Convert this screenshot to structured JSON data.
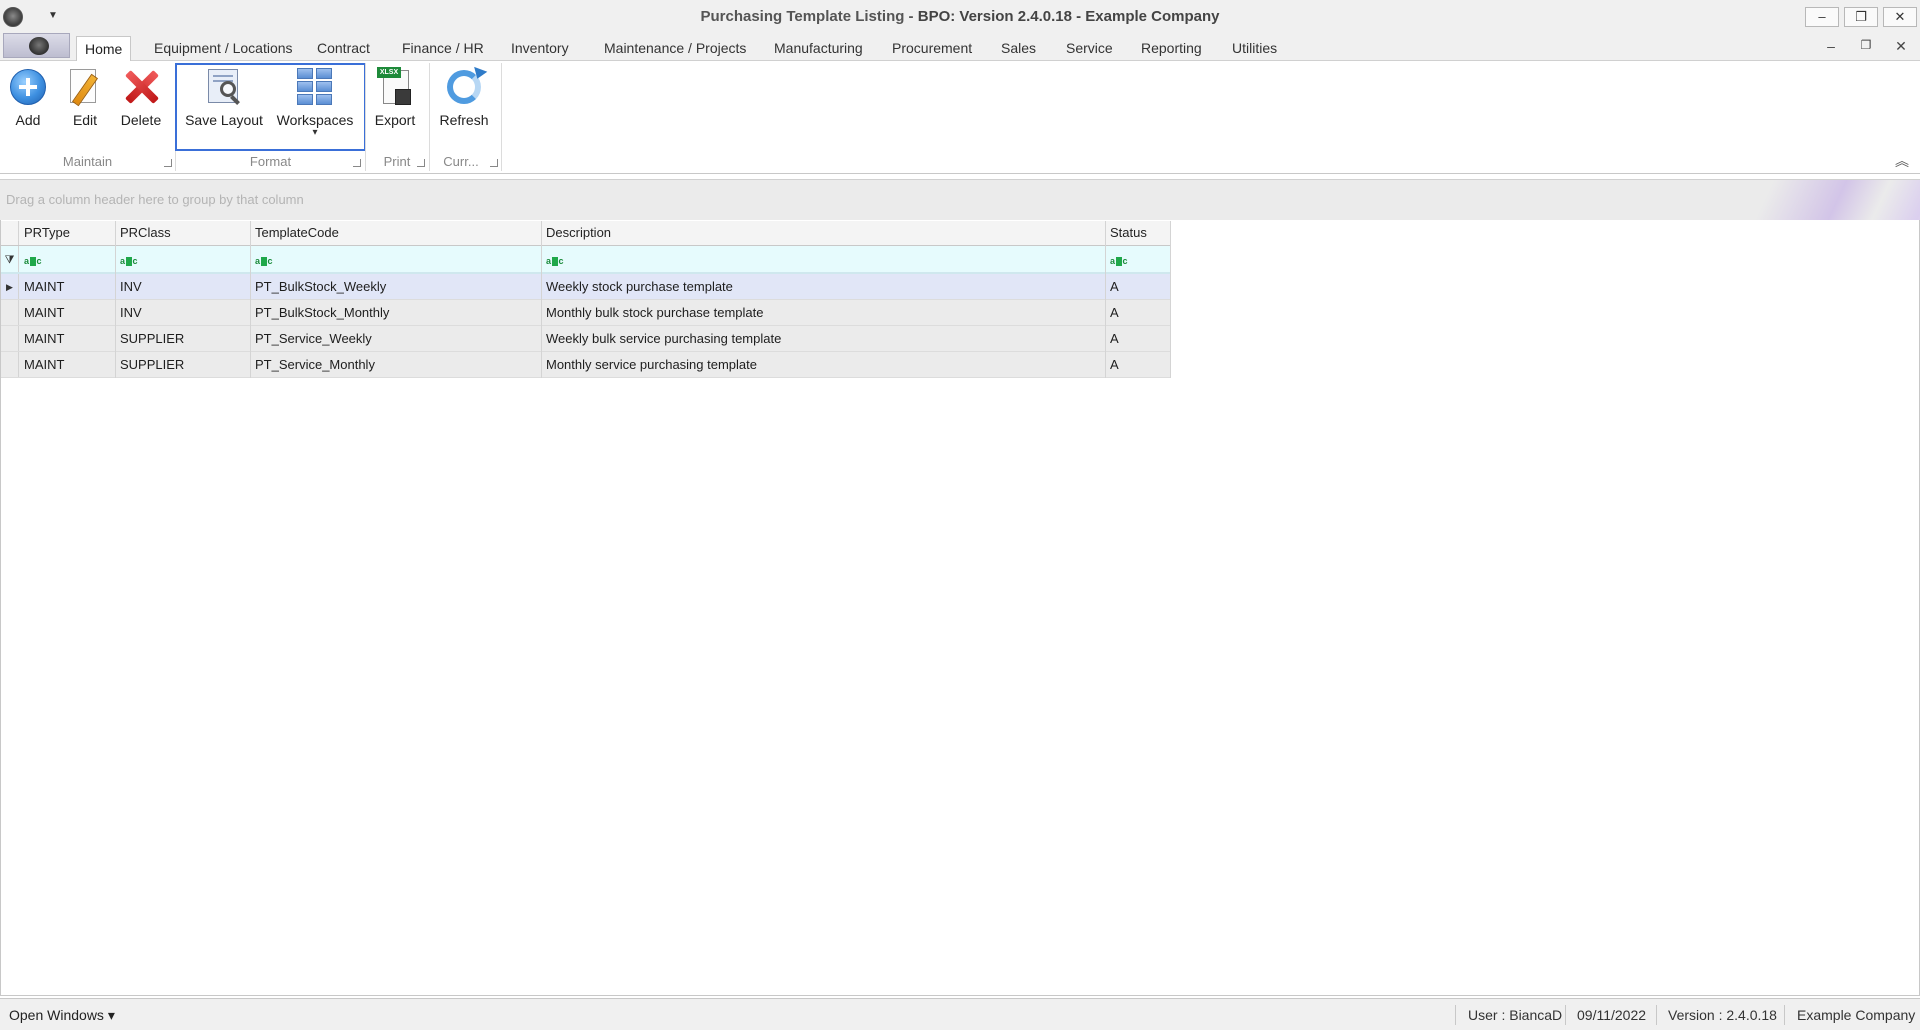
{
  "window": {
    "title_main": "Purchasing Template Listing - ",
    "title_sub": "BPO: Version 2.4.0.18 - Example Company",
    "minimize": "–",
    "restore": "❐",
    "close": "✕"
  },
  "qat_dropdown_glyph": "▼",
  "tabs": [
    {
      "label": "Home",
      "active": true
    },
    {
      "label": "Equipment / Locations"
    },
    {
      "label": "Contract"
    },
    {
      "label": "Finance / HR"
    },
    {
      "label": "Inventory"
    },
    {
      "label": "Maintenance / Projects"
    },
    {
      "label": "Manufacturing"
    },
    {
      "label": "Procurement"
    },
    {
      "label": "Sales"
    },
    {
      "label": "Service"
    },
    {
      "label": "Reporting"
    },
    {
      "label": "Utilities"
    }
  ],
  "mdi": {
    "minimize": "–",
    "restore": "❐",
    "close": "✕"
  },
  "ribbon": {
    "buttons": {
      "add": "Add",
      "edit": "Edit",
      "delete": "Delete",
      "save_layout": "Save Layout",
      "workspaces": "Workspaces",
      "export": "Export",
      "refresh": "Refresh"
    },
    "groups": {
      "maintain": "Maintain",
      "format": "Format",
      "print": "Print",
      "current": "Curr..."
    },
    "export_tag": "XLSX",
    "workspaces_arrow": "▾",
    "collapse_glyph": "︽"
  },
  "groupby_hint": "Drag a column header here to group by that column",
  "grid": {
    "columns": [
      "PRType",
      "PRClass",
      "TemplateCode",
      "Description",
      "Status"
    ],
    "filter_icon": "⧩",
    "row_indicator": "▶",
    "rows": [
      {
        "PRType": "MAINT",
        "PRClass": "INV",
        "TemplateCode": "PT_BulkStock_Weekly",
        "Description": "Weekly stock purchase template",
        "Status": "A"
      },
      {
        "PRType": "MAINT",
        "PRClass": "INV",
        "TemplateCode": "PT_BulkStock_Monthly",
        "Description": "Monthly bulk stock purchase template",
        "Status": "A"
      },
      {
        "PRType": "MAINT",
        "PRClass": "SUPPLIER",
        "TemplateCode": "PT_Service_Weekly",
        "Description": "Weekly bulk service purchasing template",
        "Status": "A"
      },
      {
        "PRType": "MAINT",
        "PRClass": "SUPPLIER",
        "TemplateCode": "PT_Service_Monthly",
        "Description": "Monthly service purchasing template",
        "Status": "A"
      }
    ]
  },
  "statusbar": {
    "open_windows": "Open Windows ▾",
    "user": "User : BiancaD",
    "date": "09/11/2022",
    "version": "Version : 2.4.0.18",
    "company": "Example Company"
  }
}
